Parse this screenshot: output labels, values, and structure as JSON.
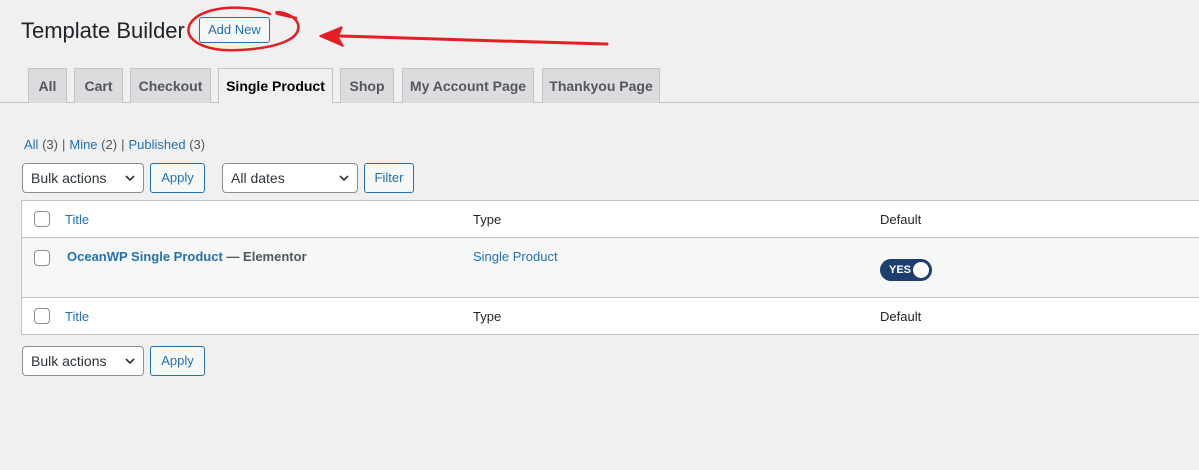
{
  "header": {
    "title": "Template Builder",
    "add_new_label": "Add New"
  },
  "annotation": {
    "color": "#e31e24",
    "shapes": [
      "circle-highlight",
      "arrow-left"
    ]
  },
  "tabs": [
    {
      "label": "All"
    },
    {
      "label": "Cart"
    },
    {
      "label": "Checkout"
    },
    {
      "label": "Single Product",
      "active": true
    },
    {
      "label": "Shop"
    },
    {
      "label": "My Account Page"
    },
    {
      "label": "Thankyou Page"
    }
  ],
  "filters_links": [
    {
      "label": "All",
      "count": "(3)"
    },
    {
      "label": "Mine",
      "count": "(2)"
    },
    {
      "label": "Published",
      "count": "(3)"
    }
  ],
  "separator": "|",
  "toolbar": {
    "bulk_actions": "Bulk actions",
    "apply": "Apply",
    "dates": "All dates",
    "filter": "Filter"
  },
  "table": {
    "columns": {
      "title": "Title",
      "type": "Type",
      "default": "Default"
    },
    "rows": [
      {
        "title": "OceanWP Single Product",
        "state": "— Elementor",
        "type": "Single Product",
        "default_toggle": "YES"
      }
    ]
  },
  "toolbar_bottom": {
    "bulk_actions": "Bulk actions",
    "apply": "Apply"
  },
  "colors": {
    "accent": "#2271b1",
    "toggle_on": "#1d3f6f",
    "background": "#f0f0f1"
  }
}
